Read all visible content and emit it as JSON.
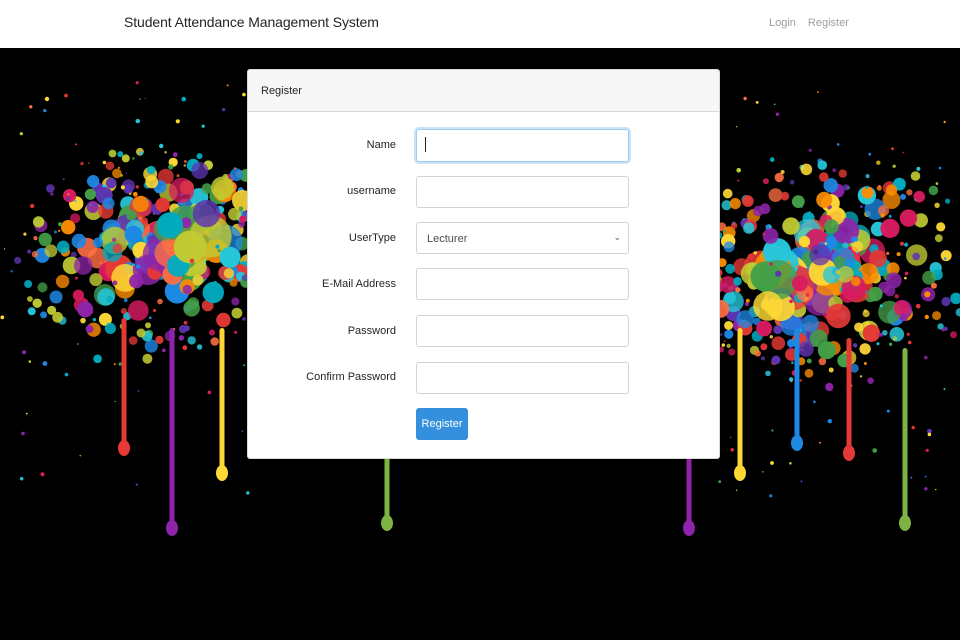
{
  "navbar": {
    "brand": "Student Attendance Management System",
    "links": [
      "Login",
      "Register"
    ]
  },
  "card": {
    "header": "Register"
  },
  "form": {
    "name_label": "Name",
    "name_value": "",
    "username_label": "username",
    "username_value": "",
    "usertype_label": "UserType",
    "usertype_value": "Lecturer",
    "email_label": "E-Mail Address",
    "email_value": "",
    "password_label": "Password",
    "confirm_label": "Confirm Password",
    "submit_label": "Register"
  },
  "colors": {
    "primary": "#3490dc",
    "focus_border": "#9ecdf2",
    "page_background": "#000000"
  },
  "icons": {
    "select_caret": "chevron-down-icon"
  }
}
